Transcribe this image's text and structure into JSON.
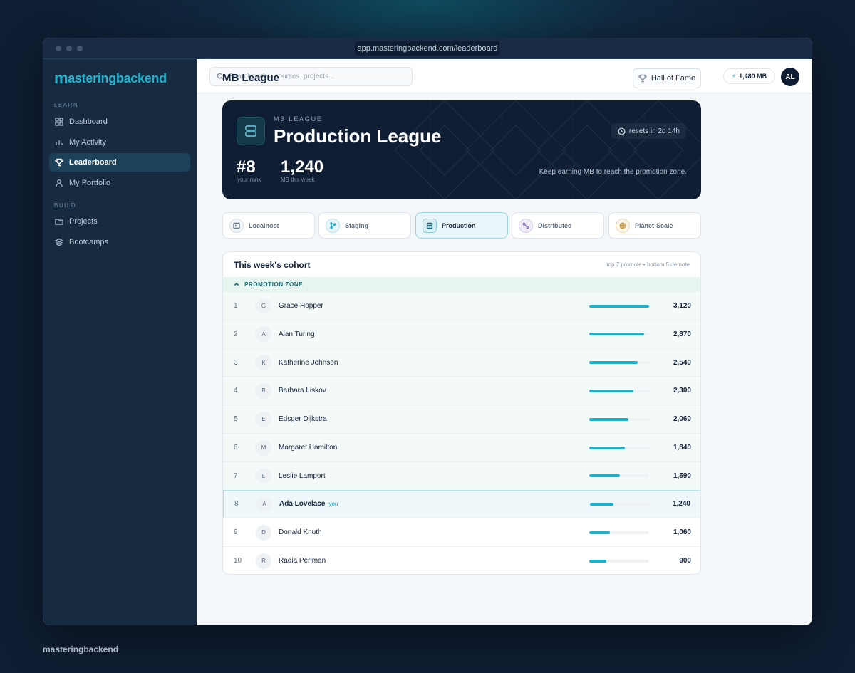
{
  "browser": {
    "url": "app.masteringbackend.com/leaderboard"
  },
  "brand": {
    "logo_mark": "m",
    "logo_text": "asteringbackend",
    "footer_text": "masteringbackend"
  },
  "sidebar": {
    "learn_label": "LEARN",
    "build_label": "BUILD",
    "items": [
      {
        "label": "Dashboard",
        "icon": "grid-icon"
      },
      {
        "label": "My Activity",
        "icon": "bar-chart-icon"
      },
      {
        "label": "Leaderboard",
        "icon": "trophy-icon",
        "active": true
      },
      {
        "label": "My Portfolio",
        "icon": "user-icon"
      },
      {
        "label": "Projects",
        "icon": "folder-icon"
      },
      {
        "label": "Bootcamps",
        "icon": "layers-icon"
      }
    ]
  },
  "topbar": {
    "search_placeholder": "Search paths, courses, projects...",
    "credits": "1,480 MB",
    "avatar_initials": "AL"
  },
  "page": {
    "title": "MB League",
    "hof_label": "Hall of Fame"
  },
  "hero": {
    "kicker": "MB LEAGUE",
    "title": "Production League",
    "resets": "resets in 2d 14h",
    "rank_value": "#8",
    "rank_label": "your rank",
    "mb_value": "1,240",
    "mb_label": "MB this week",
    "message": "Keep earning MB to reach the promotion zone."
  },
  "tiers": [
    {
      "label": "Localhost",
      "icon": "terminal-icon",
      "color": "#6b7b8b"
    },
    {
      "label": "Staging",
      "icon": "git-branch-icon",
      "color": "#1aa6c4"
    },
    {
      "label": "Production",
      "icon": "server-icon",
      "color": "#1e6f78",
      "active": true
    },
    {
      "label": "Distributed",
      "icon": "network-icon",
      "color": "#8a6fc0"
    },
    {
      "label": "Planet-Scale",
      "icon": "globe-icon",
      "color": "#c9a24f"
    }
  ],
  "cohort": {
    "title": "This week's cohort",
    "note": "top 7 promote • bottom 5 demote",
    "zone_label": "PROMOTION ZONE",
    "you_label": "you",
    "max_score": 3120,
    "rows": [
      {
        "rank": "1",
        "initial": "G",
        "name": "Grace Hopper",
        "score": "3,120",
        "value": 3120
      },
      {
        "rank": "2",
        "initial": "A",
        "name": "Alan Turing",
        "score": "2,870",
        "value": 2870
      },
      {
        "rank": "3",
        "initial": "K",
        "name": "Katherine Johnson",
        "score": "2,540",
        "value": 2540
      },
      {
        "rank": "4",
        "initial": "B",
        "name": "Barbara Liskov",
        "score": "2,300",
        "value": 2300
      },
      {
        "rank": "5",
        "initial": "E",
        "name": "Edsger Dijkstra",
        "score": "2,060",
        "value": 2060
      },
      {
        "rank": "6",
        "initial": "M",
        "name": "Margaret Hamilton",
        "score": "1,840",
        "value": 1840
      },
      {
        "rank": "7",
        "initial": "L",
        "name": "Leslie Lamport",
        "score": "1,590",
        "value": 1590
      },
      {
        "rank": "8",
        "initial": "A",
        "name": "Ada Lovelace",
        "score": "1,240",
        "value": 1240,
        "me": true
      },
      {
        "rank": "9",
        "initial": "D",
        "name": "Donald Knuth",
        "score": "1,060",
        "value": 1060
      },
      {
        "rank": "10",
        "initial": "R",
        "name": "Radia Perlman",
        "score": "900",
        "value": 900
      }
    ]
  }
}
